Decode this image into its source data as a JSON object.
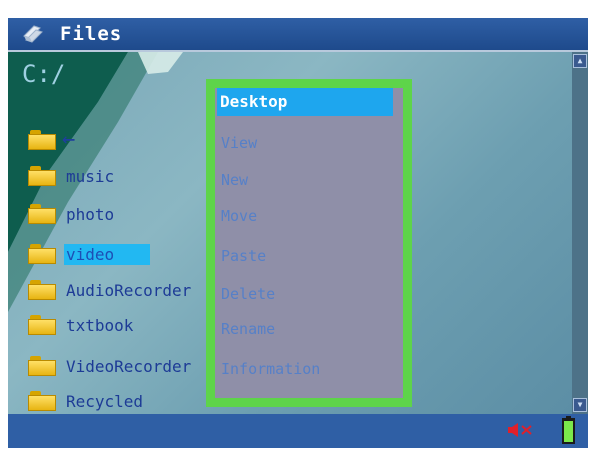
{
  "window": {
    "title": "Files"
  },
  "browser": {
    "path": "C:/",
    "back_arrow": "←",
    "items": [
      {
        "label": "music"
      },
      {
        "label": "photo"
      },
      {
        "label": "video"
      },
      {
        "label": "AudioRecorder"
      },
      {
        "label": "txtbook"
      },
      {
        "label": "VideoRecorder"
      },
      {
        "label": "Recycled"
      }
    ],
    "selected": "video"
  },
  "context_menu": {
    "items": [
      "Desktop",
      "View",
      "New",
      "Move",
      "Paste",
      "Delete",
      "Rename",
      "Information"
    ],
    "selected": "Desktop"
  },
  "status": {
    "icons": [
      "speaker-muted-icon",
      "battery-icon"
    ]
  },
  "colors": {
    "title_bar": "#2f5fa5",
    "menu_border": "#5ed44a",
    "menu_bg": "#8f8fa8",
    "highlight": "#1ea6ee",
    "file_text": "#1d3b96"
  }
}
